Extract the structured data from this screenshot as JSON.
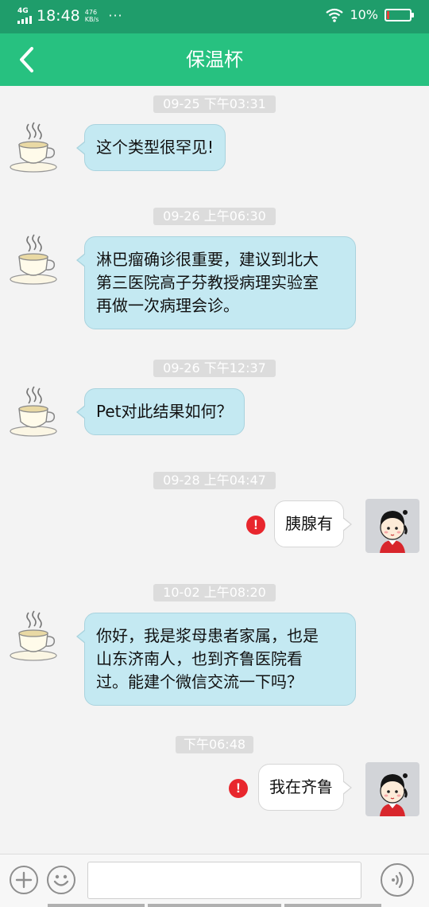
{
  "status_bar": {
    "network": "4G",
    "time": "18:48",
    "speed_value": "476",
    "speed_unit": "KB/s",
    "more": "···",
    "battery_percent": "10%",
    "battery_level": 0.1,
    "battery_color": "#e5423a"
  },
  "header": {
    "title": "保温杯",
    "back_icon": "chevron-left-icon",
    "color": "#27c180"
  },
  "messages": [
    {
      "timestamp": "09-25 下午03:31",
      "direction": "incoming",
      "text_lines": [
        "这个类型很罕见!"
      ]
    },
    {
      "timestamp": "09-26 上午06:30",
      "direction": "incoming",
      "text_lines": [
        "淋巴瘤确诊很重要，建议到北大",
        "第三医院高子芬教授病理实验室",
        "再做一次病理会诊。"
      ]
    },
    {
      "timestamp": "09-26 下午12:37",
      "direction": "incoming",
      "text_lines": [
        "Pet对此结果如何？"
      ]
    },
    {
      "timestamp": "09-28 上午04:47",
      "direction": "outgoing",
      "text_lines": [
        "胰腺有"
      ],
      "failed": true
    },
    {
      "timestamp": "10-02 上午08:20",
      "direction": "incoming",
      "text_lines": [
        "你好，我是浆母患者家属，也是",
        "山东济南人，也到齐鲁医院看",
        "过。能建个微信交流一下吗？"
      ]
    },
    {
      "timestamp": "下午06:48",
      "direction": "outgoing",
      "text_lines": [
        "我在齐鲁"
      ],
      "failed": true
    }
  ],
  "error_mark": "!",
  "input_bar": {
    "add_icon": "plus-icon",
    "emoji_icon": "smiley-icon",
    "voice_icon": "voice-icon",
    "text_value": ""
  }
}
